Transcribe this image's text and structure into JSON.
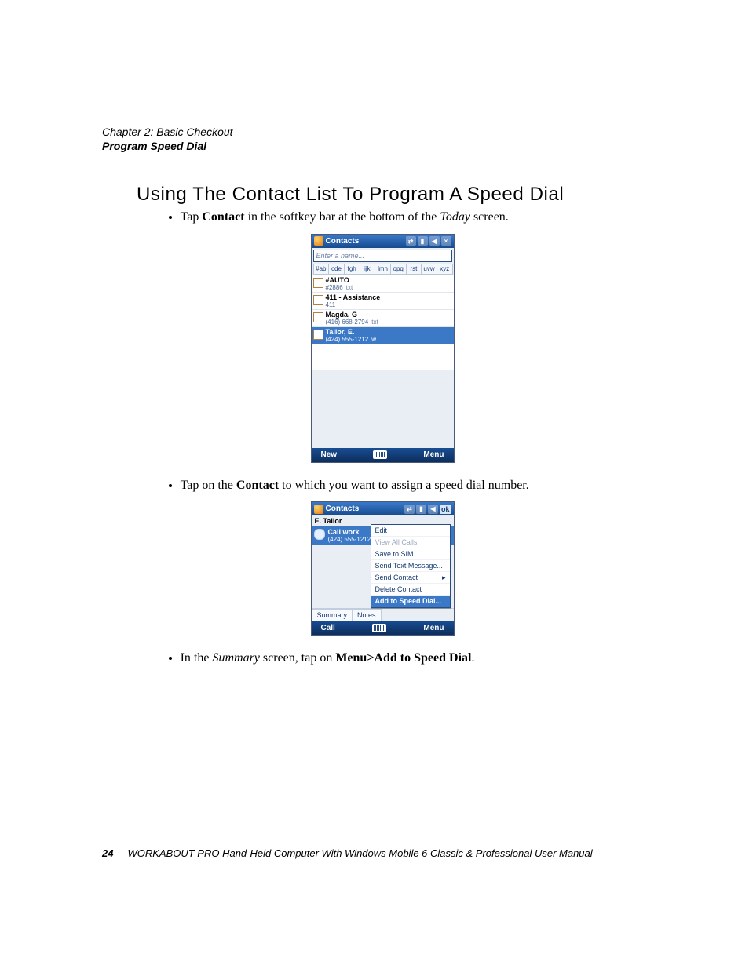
{
  "header": {
    "chapter": "Chapter 2: Basic Checkout",
    "section": "Program Speed Dial"
  },
  "title": "Using The Contact List To Program A Speed Dial",
  "bullet1": {
    "pre": "Tap ",
    "bold": "Contact",
    "mid": " in the softkey bar at the bottom of the ",
    "ital": "Today",
    "post": " screen."
  },
  "bullet2": {
    "pre": "Tap on the ",
    "bold": "Contact",
    "post": " to which you want to assign a speed dial number."
  },
  "bullet3": {
    "pre": "In the ",
    "ital": "Summary",
    "mid": " screen, tap on ",
    "bold": "Menu>Add to Speed Dial",
    "post": "."
  },
  "screens": {
    "contacts": {
      "title": "Contacts",
      "close_label": "×",
      "search_placeholder": "Enter a name...",
      "alpha": [
        "#ab",
        "cde",
        "fgh",
        "ijk",
        "lmn",
        "opq",
        "rst",
        "uvw",
        "xyz"
      ],
      "rows": [
        {
          "name": "#AUTO",
          "sub": "#2886",
          "trailing": "txt",
          "icon": "contact"
        },
        {
          "name": "411 - Assistance",
          "sub": "411",
          "trailing": "",
          "icon": "sim"
        },
        {
          "name": "Magda, G",
          "sub": "(416) 668-2794",
          "trailing": "txt",
          "icon": "contact"
        },
        {
          "name": "Tailor, E.",
          "sub": "(424) 555-1212",
          "trailing": "w",
          "icon": "contact",
          "selected": true
        }
      ],
      "softLeft": "New",
      "softRight": "Menu"
    },
    "detail": {
      "title": "Contacts",
      "ok": "ok",
      "contactName": "E. Tailor",
      "callLabel": "Call work",
      "callNumber": "(424) 555-1212",
      "tabs": [
        "Summary",
        "Notes"
      ],
      "menu": [
        {
          "label": "Edit",
          "u": "E"
        },
        {
          "label": "View All Calls",
          "disabled": true
        },
        {
          "label": "Save to SIM",
          "u": "S"
        },
        {
          "label": "Send Text Message...",
          "u": "n"
        },
        {
          "label": "Send Contact",
          "arrow": true
        },
        {
          "label": "Delete Contact",
          "u": "D"
        },
        {
          "label": "Add to Speed Dial...",
          "u": "A",
          "highlight": true
        }
      ],
      "softLeft": "Call",
      "softRight": "Menu"
    }
  },
  "footer": {
    "page": "24",
    "title": "WORKABOUT PRO Hand-Held Computer With Windows Mobile 6 Classic & Professional User Manual"
  }
}
